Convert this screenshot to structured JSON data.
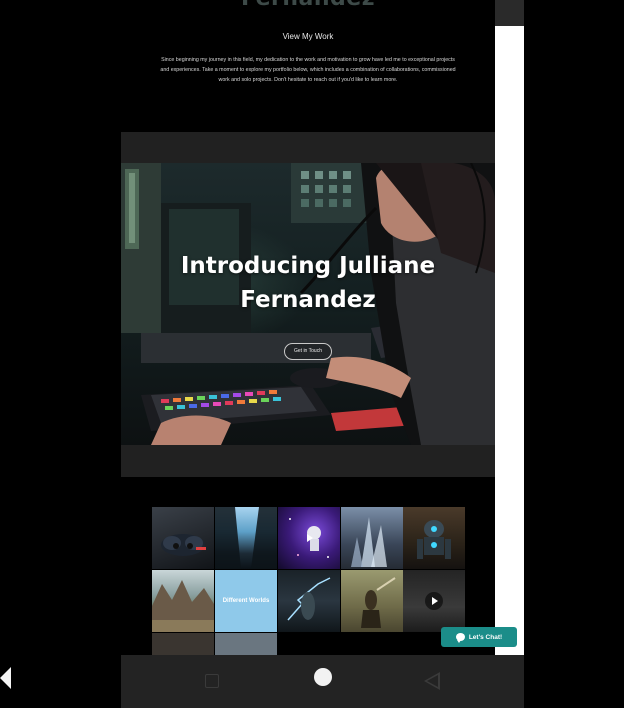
{
  "hero_top": {
    "partial_title": "Fernandez",
    "view_work_link": "View My Work",
    "intro_paragraph": "Since beginning my journey in this field, my dedication to the work and motivation to grow have led me to exceptional projects and experiences. Take a moment to explore my portfolio below, which includes a combination of collaborations, commissioned work and solo projects. Don't hesitate to reach out if you'd like to learn more."
  },
  "hero": {
    "heading_line1": "Introducing Julliane",
    "heading_line2": "Fernandez",
    "button_label": "Get in Touch"
  },
  "gallery": {
    "tiles": [
      {
        "name": "controller-tile",
        "label": "",
        "has_play": false
      },
      {
        "name": "sky-tile",
        "label": "",
        "has_play": false
      },
      {
        "name": "astronaut-tile",
        "label": "",
        "has_play": true
      },
      {
        "name": "crystal-tile",
        "label": "",
        "has_play": false
      },
      {
        "name": "robot-tile",
        "label": "",
        "has_play": false
      },
      {
        "name": "landscape-tile",
        "label": "",
        "has_play": false
      },
      {
        "name": "different-worlds-tile",
        "label": "Different Worlds",
        "has_play": false
      },
      {
        "name": "lightning-tile",
        "label": "",
        "has_play": false
      },
      {
        "name": "warrior-tile",
        "label": "",
        "has_play": false
      },
      {
        "name": "space-video-tile",
        "label": "",
        "has_play": true
      }
    ]
  },
  "chat": {
    "label": "Let's Chat!"
  },
  "icons": {
    "chat": "chat-bubble-icon",
    "play": "play-icon",
    "nav_recent": "square-icon",
    "nav_home": "circle-icon",
    "nav_back": "triangle-back-icon"
  },
  "colors": {
    "accent": "#1b8d89",
    "hero_section_bg": "#212121",
    "page_bg": "#000000",
    "navbar_bg": "#232323"
  }
}
